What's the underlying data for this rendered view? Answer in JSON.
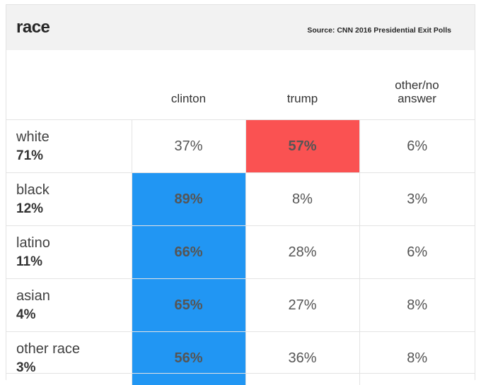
{
  "header": {
    "title": "race",
    "source": "Source: CNN 2016 Presidential Exit Polls"
  },
  "colors": {
    "clinton_win": "#2196f3",
    "trump_win": "#fa5252"
  },
  "chart_data": {
    "type": "table",
    "title": "race",
    "source": "Source: CNN 2016 Presidential Exit Polls",
    "columns": [
      "clinton",
      "trump",
      "other/no answer"
    ],
    "rows": [
      {
        "group": "white",
        "share": "71%",
        "values": [
          "37%",
          "57%",
          "6%"
        ],
        "winner": 1
      },
      {
        "group": "black",
        "share": "12%",
        "values": [
          "89%",
          "8%",
          "3%"
        ],
        "winner": 0
      },
      {
        "group": "latino",
        "share": "11%",
        "values": [
          "66%",
          "28%",
          "6%"
        ],
        "winner": 0
      },
      {
        "group": "asian",
        "share": "4%",
        "values": [
          "65%",
          "27%",
          "8%"
        ],
        "winner": 0
      },
      {
        "group": "other race",
        "share": "3%",
        "values": [
          "56%",
          "36%",
          "8%"
        ],
        "winner": 0
      }
    ]
  }
}
